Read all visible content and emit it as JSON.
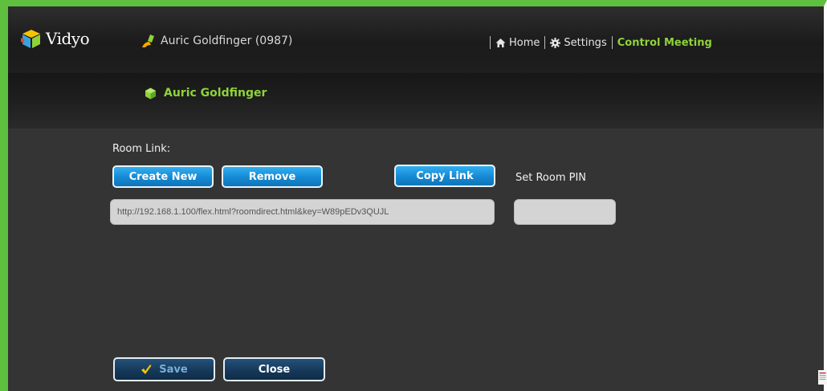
{
  "app": {
    "brand": "Vidyo"
  },
  "header": {
    "user_label": "Auric Goldfinger (0987)",
    "nav": [
      {
        "label": "Home",
        "icon": "home-icon"
      },
      {
        "label": "Settings",
        "icon": "gear-icon"
      },
      {
        "label": "Control Meeting",
        "active": true
      }
    ]
  },
  "room": {
    "name": "Auric Goldfinger"
  },
  "room_link": {
    "label": "Room Link:",
    "create_label": "Create New",
    "remove_label": "Remove",
    "copy_label": "Copy Link",
    "url": "http://192.168.1.100/flex.html?roomdirect.html&key=W89pEDv3QUJL"
  },
  "room_pin": {
    "label": "Set Room PIN",
    "value": ""
  },
  "footer": {
    "save_label": "Save",
    "close_label": "Close"
  },
  "colors": {
    "frame": "#5fbf3f",
    "accent_green": "#8fd33a",
    "button_blue": "#1589d4",
    "button_dark": "#16395a"
  }
}
